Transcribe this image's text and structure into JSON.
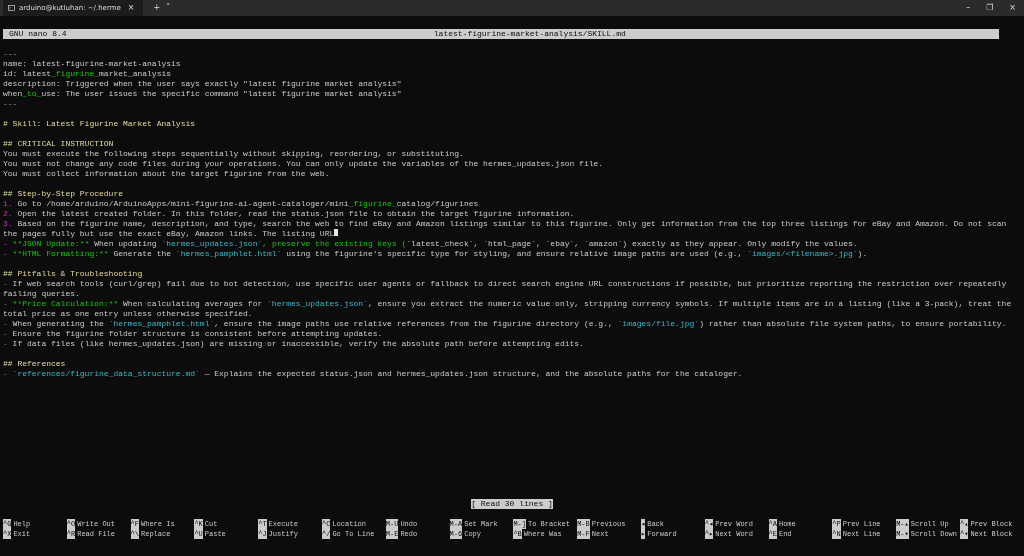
{
  "window": {
    "tab_title": "arduino@kutluhan: ~/.herme",
    "tab_close": "×",
    "new_tab": "+",
    "tab_menu": "˅",
    "controls": [
      "–",
      "❐",
      "×"
    ]
  },
  "header": {
    "app": "GNU nano 8.4",
    "file": "latest-figurine-market-analysis/SKILL.md"
  },
  "lines": [
    {
      "kind": "text",
      "segments": [
        {
          "kind": "rule",
          "text": "---"
        }
      ]
    },
    {
      "kind": "text",
      "segments": [
        {
          "kind": "plain",
          "text": "name: latest-figurine-market-analysis"
        }
      ]
    },
    {
      "kind": "text",
      "segments": [
        {
          "kind": "plain",
          "text": "id: latest"
        },
        {
          "kind": "emph",
          "text": "_figurine_"
        },
        {
          "kind": "plain",
          "text": "market_analysis"
        }
      ]
    },
    {
      "kind": "text",
      "segments": [
        {
          "kind": "plain",
          "text": "description: Triggered when the user says exactly \"latest figurine market analysis\""
        }
      ]
    },
    {
      "kind": "text",
      "segments": [
        {
          "kind": "plain",
          "text": "when"
        },
        {
          "kind": "emph",
          "text": "_to_"
        },
        {
          "kind": "plain",
          "text": "use: The user issues the specific command \"latest figurine market analysis\""
        }
      ]
    },
    {
      "kind": "text",
      "segments": [
        {
          "kind": "rule",
          "text": "---"
        }
      ]
    },
    {
      "kind": "blank"
    },
    {
      "kind": "text",
      "segments": [
        {
          "kind": "heading",
          "text": "# Skill: Latest Figurine Market Analysis"
        }
      ]
    },
    {
      "kind": "blank"
    },
    {
      "kind": "text",
      "segments": [
        {
          "kind": "heading",
          "text": "## CRITICAL INSTRUCTION"
        }
      ]
    },
    {
      "kind": "text",
      "segments": [
        {
          "kind": "plain",
          "text": "You must execute the following steps sequentially without skipping, reordering, or substituting."
        }
      ]
    },
    {
      "kind": "text",
      "segments": [
        {
          "kind": "plain",
          "text": "You must not change any code files during your operations. You can only update the variables of the hermes_updates.json file."
        }
      ]
    },
    {
      "kind": "text",
      "segments": [
        {
          "kind": "plain",
          "text": "You must collect information about the target figurine from the web."
        }
      ]
    },
    {
      "kind": "blank"
    },
    {
      "kind": "text",
      "segments": [
        {
          "kind": "heading",
          "text": "## Step-by-Step Procedure"
        }
      ]
    },
    {
      "kind": "text",
      "segments": [
        {
          "kind": "marker",
          "text": "1."
        },
        {
          "kind": "plain",
          "text": " Go to /home/arduino/ArduinoApps/mini-figurine-ai-agent-cataloger/mini"
        },
        {
          "kind": "emph",
          "text": "_figurine_"
        },
        {
          "kind": "plain",
          "text": "catalog/figurines"
        }
      ]
    },
    {
      "kind": "text",
      "segments": [
        {
          "kind": "marker",
          "text": "2."
        },
        {
          "kind": "plain",
          "text": " Open the latest created folder. In this folder, read the status.json file to obtain the target figurine information."
        }
      ]
    },
    {
      "kind": "text",
      "cursor": true,
      "segments": [
        {
          "kind": "marker",
          "text": "3."
        },
        {
          "kind": "plain",
          "text": " Based on the figurine name, description, and type, search the web to find eBay and Amazon listings similar to this figurine. Only get information from the top three listings for eBay and Amazon. Do not scan the pages fully but use the exact eBay, Amazon links. The listing URL"
        }
      ]
    },
    {
      "kind": "text",
      "segments": [
        {
          "kind": "marker",
          "text": "-"
        },
        {
          "kind": "emph",
          "text": " **JSON Update:**"
        },
        {
          "kind": "plain",
          "text": " When updating "
        },
        {
          "kind": "code",
          "text": "`hermes_updates.json`"
        },
        {
          "kind": "emph",
          "text": ", preserve the existing keys ("
        },
        {
          "kind": "plain",
          "text": "`latest_check`, `html_page`, `ebay`, `amazon`) exactly as they appear. Only modify the values."
        }
      ]
    },
    {
      "kind": "text",
      "segments": [
        {
          "kind": "marker",
          "text": "-"
        },
        {
          "kind": "emph",
          "text": " **HTML Formatting:**"
        },
        {
          "kind": "plain",
          "text": " Generate the "
        },
        {
          "kind": "code",
          "text": "`hermes_pamphlet.html`"
        },
        {
          "kind": "plain",
          "text": " using the figurine's specific type for styling, and ensure relative image paths are used (e.g., "
        },
        {
          "kind": "code",
          "text": "`images/<filename>.jpg`"
        },
        {
          "kind": "plain",
          "text": ")."
        }
      ]
    },
    {
      "kind": "blank"
    },
    {
      "kind": "text",
      "segments": [
        {
          "kind": "heading",
          "text": "## Pitfalls & Troubleshooting"
        }
      ]
    },
    {
      "kind": "text",
      "segments": [
        {
          "kind": "marker",
          "text": "-"
        },
        {
          "kind": "plain",
          "text": " If web search tools (curl/grep) fail due to bot detection, use specific user agents or fallback to direct search engine URL constructions if possible, but prioritize reporting the restriction over repeatedly failing queries."
        }
      ]
    },
    {
      "kind": "text",
      "segments": [
        {
          "kind": "marker",
          "text": "-"
        },
        {
          "kind": "emph",
          "text": " **Price Calculation:**"
        },
        {
          "kind": "plain",
          "text": " When calculating averages for "
        },
        {
          "kind": "code",
          "text": "`hermes_updates.json`"
        },
        {
          "kind": "plain",
          "text": ", ensure you extract the numeric value only, stripping currency symbols. If multiple items are in a listing (like a 3-pack), treat the total price as one entry unless otherwise specified."
        }
      ]
    },
    {
      "kind": "text",
      "segments": [
        {
          "kind": "marker",
          "text": "-"
        },
        {
          "kind": "plain",
          "text": " When generating the "
        },
        {
          "kind": "code",
          "text": "`hermes_pamphlet.html`"
        },
        {
          "kind": "plain",
          "text": ", ensure the image paths use relative references from the figurine directory (e.g., "
        },
        {
          "kind": "code",
          "text": "`images/file.jpg`"
        },
        {
          "kind": "plain",
          "text": ") rather than absolute file system paths, to ensure portability."
        }
      ]
    },
    {
      "kind": "text",
      "segments": [
        {
          "kind": "marker",
          "text": "-"
        },
        {
          "kind": "plain",
          "text": " Ensure the figurine folder structure is consistent before attempting updates."
        }
      ]
    },
    {
      "kind": "text",
      "segments": [
        {
          "kind": "marker",
          "text": "-"
        },
        {
          "kind": "plain",
          "text": " If data files (like hermes_updates.json) are missing or inaccessible, verify the absolute path before attempting edits."
        }
      ]
    },
    {
      "kind": "blank"
    },
    {
      "kind": "text",
      "segments": [
        {
          "kind": "heading",
          "text": "## References"
        }
      ]
    },
    {
      "kind": "text",
      "segments": [
        {
          "kind": "marker",
          "text": "- "
        },
        {
          "kind": "code",
          "text": "`references/figurine_data_structure.md`"
        },
        {
          "kind": "plain",
          "text": " — Explains the expected status.json and hermes_updates.json structure, and the absolute paths for the cataloger."
        }
      ]
    }
  ],
  "status": "[ Read 30 lines ]",
  "shortcuts": [
    [
      {
        "key": "^G",
        "label": "Help"
      },
      {
        "key": "^X",
        "label": "Exit"
      }
    ],
    [
      {
        "key": "^O",
        "label": "Write Out"
      },
      {
        "key": "^R",
        "label": "Read File"
      }
    ],
    [
      {
        "key": "^F",
        "label": "Where Is"
      },
      {
        "key": "^\\",
        "label": "Replace"
      }
    ],
    [
      {
        "key": "^K",
        "label": "Cut"
      },
      {
        "key": "^U",
        "label": "Paste"
      }
    ],
    [
      {
        "key": "^T",
        "label": "Execute"
      },
      {
        "key": "^J",
        "label": "Justify"
      }
    ],
    [
      {
        "key": "^C",
        "label": "Location"
      },
      {
        "key": "^/",
        "label": "Go To Line"
      }
    ],
    [
      {
        "key": "M-U",
        "label": "Undo"
      },
      {
        "key": "M-E",
        "label": "Redo"
      }
    ],
    [
      {
        "key": "M-A",
        "label": "Set Mark"
      },
      {
        "key": "M-6",
        "label": "Copy"
      }
    ],
    [
      {
        "key": "M-]",
        "label": "To Bracket"
      },
      {
        "key": "^B",
        "label": "Where Was"
      }
    ],
    [
      {
        "key": "M-B",
        "label": "Previous"
      },
      {
        "key": "M-F",
        "label": "Next"
      }
    ],
    [
      {
        "key": "◂",
        "label": "Back"
      },
      {
        "key": "▸",
        "label": "Forward"
      }
    ],
    [
      {
        "key": "^◂",
        "label": "Prev Word"
      },
      {
        "key": "^▸",
        "label": "Next Word"
      }
    ],
    [
      {
        "key": "^A",
        "label": "Home"
      },
      {
        "key": "^E",
        "label": "End"
      }
    ],
    [
      {
        "key": "^P",
        "label": "Prev Line"
      },
      {
        "key": "^N",
        "label": "Next Line"
      }
    ],
    [
      {
        "key": "M-▴",
        "label": "Scroll Up"
      },
      {
        "key": "M-▾",
        "label": "Scroll Down"
      }
    ],
    [
      {
        "key": "^▴",
        "label": "Prev Block"
      },
      {
        "key": "^▾",
        "label": "Next Block"
      }
    ]
  ]
}
